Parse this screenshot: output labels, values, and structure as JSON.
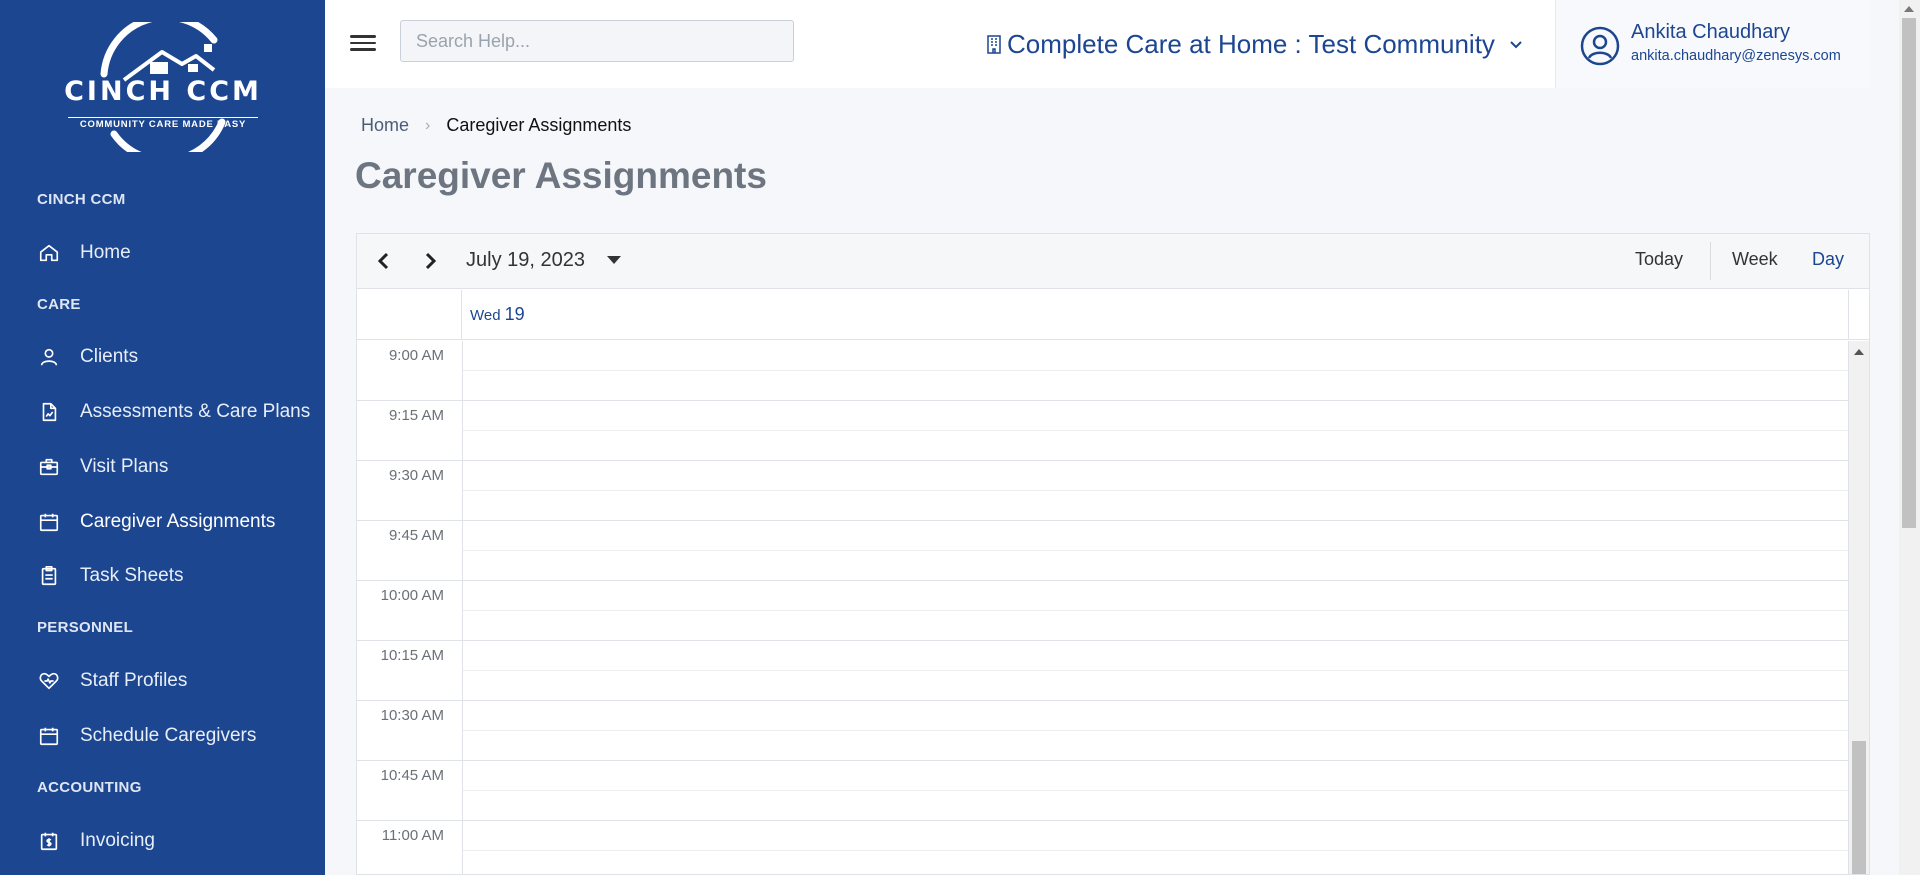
{
  "brand": {
    "logo_name": "CINCH CCM",
    "logo_tagline": "COMMUNITY CARE MADE EASY"
  },
  "sidebar": {
    "sections": [
      {
        "title": "CINCH CCM"
      },
      {
        "title": "CARE"
      },
      {
        "title": "PERSONNEL"
      },
      {
        "title": "ACCOUNTING"
      }
    ],
    "items": [
      {
        "label": "Home",
        "icon": "home-icon"
      },
      {
        "label": "Clients",
        "icon": "user-icon"
      },
      {
        "label": "Assessments & Care Plans",
        "icon": "document-chart-icon"
      },
      {
        "label": "Visit Plans",
        "icon": "briefcase-icon"
      },
      {
        "label": "Caregiver Assignments",
        "icon": "calendar-icon",
        "active": true
      },
      {
        "label": "Task Sheets",
        "icon": "clipboard-icon"
      },
      {
        "label": "Staff Profiles",
        "icon": "heart-icon"
      },
      {
        "label": "Schedule Caregivers",
        "icon": "calendar-icon"
      },
      {
        "label": "Invoicing",
        "icon": "invoice-icon"
      }
    ]
  },
  "header": {
    "search_placeholder": "Search Help...",
    "community": "Complete Care at Home : Test Community",
    "user": {
      "name": "Ankita Chaudhary",
      "email": "ankita.chaudhary@zenesys.com"
    }
  },
  "breadcrumb": {
    "home": "Home",
    "current": "Caregiver Assignments"
  },
  "page_title": "Caregiver Assignments",
  "calendar": {
    "date_label": "July 19, 2023",
    "views": {
      "today": "Today",
      "week": "Week",
      "day": "Day"
    },
    "active_view": "Day",
    "day_header": {
      "weekday": "Wed",
      "day": "19"
    },
    "time_slots": [
      "9:00 AM",
      "9:15 AM",
      "9:30 AM",
      "9:45 AM",
      "10:00 AM",
      "10:15 AM",
      "10:30 AM",
      "10:45 AM",
      "11:00 AM"
    ]
  },
  "colors": {
    "sidebar_bg": "#1c4690",
    "accent": "#1c4690",
    "title_gray": "#6c7580"
  }
}
